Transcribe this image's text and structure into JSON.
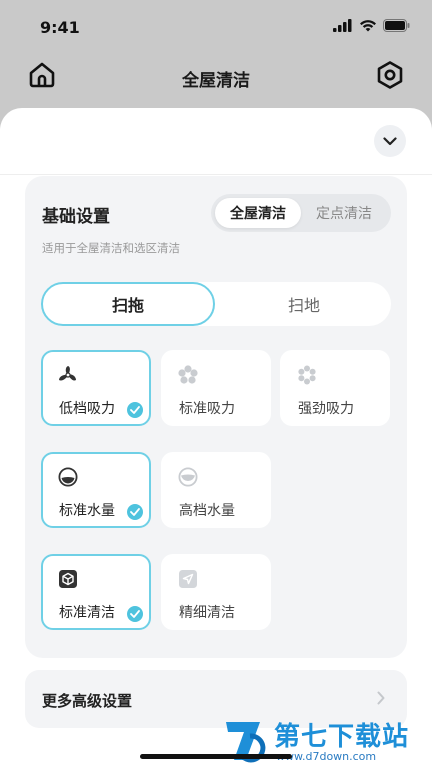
{
  "status_bar": {
    "time": "9:41"
  },
  "header": {
    "title": "全屋清洁"
  },
  "settings_card": {
    "title": "基础设置",
    "subtitle": "适用于全屋清洁和选区清洁",
    "scope_options": [
      "全屋清洁",
      "定点清洁"
    ],
    "scope_selected": "全屋清洁",
    "mode_tabs": [
      "扫拖",
      "扫地"
    ],
    "mode_selected": "扫拖",
    "suction": {
      "options": [
        "低档吸力",
        "标准吸力",
        "强劲吸力"
      ],
      "selected": "低档吸力"
    },
    "water": {
      "options": [
        "标准水量",
        "高档水量"
      ],
      "selected": "标准水量"
    },
    "clean_level": {
      "options": [
        "标准清洁",
        "精细清洁"
      ],
      "selected": "标准清洁"
    }
  },
  "more_settings": {
    "label": "更多高级设置"
  },
  "watermark": {
    "main": "第七下载站",
    "url": "www.d7down.com"
  },
  "colors": {
    "accent": "#6fd0e6",
    "check": "#4ec3de",
    "card_bg": "#f3f4f6"
  }
}
